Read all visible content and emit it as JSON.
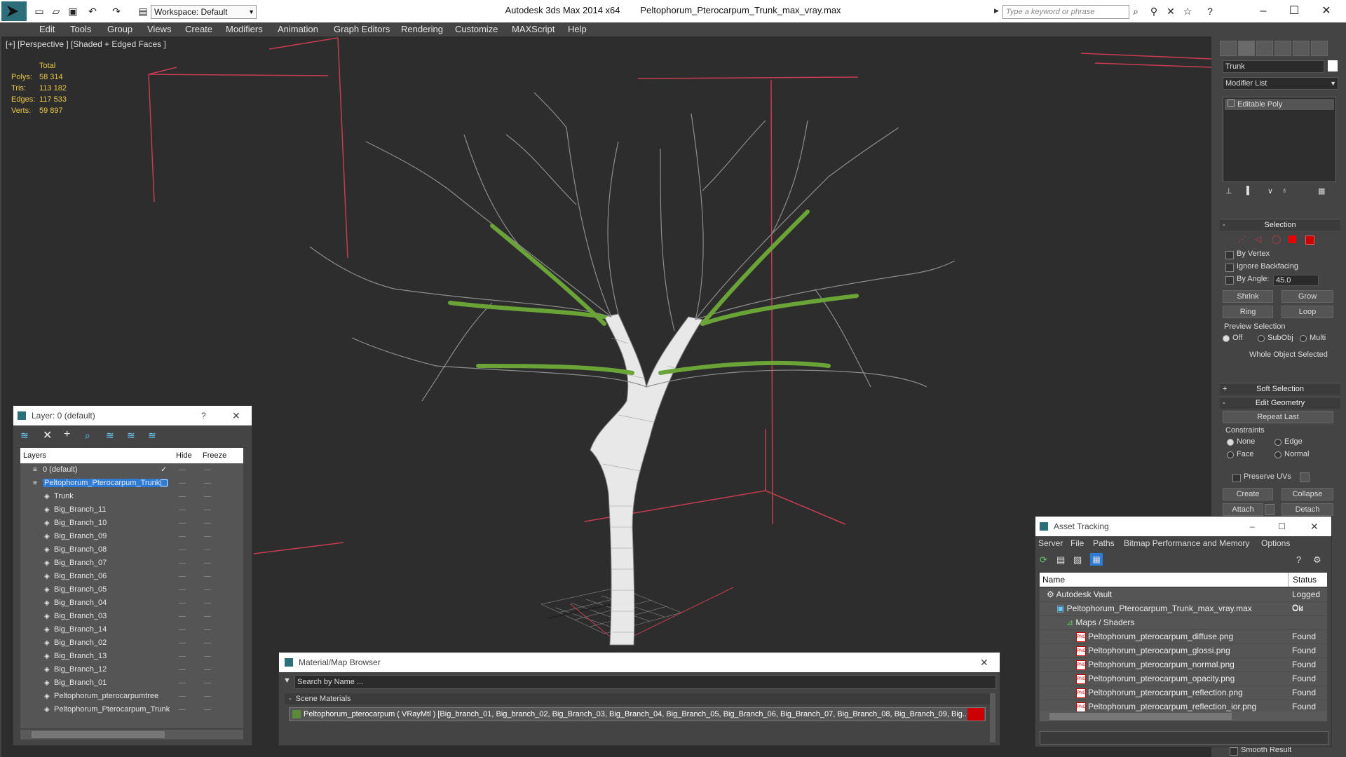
{
  "titlebar": {
    "workspace": "Workspace: Default",
    "app_title": "Autodesk 3ds Max  2014 x64",
    "file_title": "Peltophorum_Pterocarpum_Trunk_max_vray.max",
    "search_placeholder": "Type a keyword or phrase"
  },
  "menubar": [
    "Edit",
    "Tools",
    "Group",
    "Views",
    "Create",
    "Modifiers",
    "Animation",
    "Graph Editors",
    "Rendering",
    "Customize",
    "MAXScript",
    "Help"
  ],
  "viewport": {
    "label": "[+] [Perspective ] [Shaded + Edged Faces ]",
    "stats": {
      "header": "Total",
      "rows": [
        {
          "label": "Polys:",
          "value": "58 314"
        },
        {
          "label": "Tris:",
          "value": "113 182"
        },
        {
          "label": "Edges:",
          "value": "117 533"
        },
        {
          "label": "Verts:",
          "value": "59 897"
        }
      ]
    }
  },
  "cmdpanel": {
    "object_name": "Trunk",
    "modifier_list": "Modifier List",
    "stack_item": "Editable Poly",
    "selection": {
      "header": "Selection",
      "by_vertex": "By Vertex",
      "ignore_backfacing": "Ignore Backfacing",
      "by_angle": "By Angle:",
      "angle_value": "45.0",
      "shrink": "Shrink",
      "grow": "Grow",
      "ring": "Ring",
      "loop": "Loop",
      "preview_selection": "Preview Selection",
      "off": "Off",
      "subobj": "SubObj",
      "multi": "Multi",
      "status": "Whole Object Selected"
    },
    "soft_selection": "Soft Selection",
    "edit_geometry": {
      "header": "Edit Geometry",
      "repeat_last": "Repeat Last",
      "constraints": "Constraints",
      "none": "None",
      "edge": "Edge",
      "face": "Face",
      "normal": "Normal",
      "preserve_uvs": "Preserve UVs",
      "create": "Create",
      "collapse": "Collapse",
      "attach": "Attach",
      "detach": "Detach"
    },
    "smooth_result": "Smooth Result"
  },
  "layerwin": {
    "title": "Layer: 0 (default)",
    "help": "?",
    "columns": {
      "layers": "Layers",
      "hide": "Hide",
      "freeze": "Freeze"
    },
    "rows": [
      {
        "name": "0 (default)",
        "level": 1
      },
      {
        "name": "Peltophorum_Pterocarpum_Trunk",
        "level": 1,
        "selected": true
      },
      {
        "name": "Trunk",
        "level": 2
      },
      {
        "name": "Big_Branch_11",
        "level": 2
      },
      {
        "name": "Big_Branch_10",
        "level": 2
      },
      {
        "name": "Big_Branch_09",
        "level": 2
      },
      {
        "name": "Big_Branch_08",
        "level": 2
      },
      {
        "name": "Big_Branch_07",
        "level": 2
      },
      {
        "name": "Big_Branch_06",
        "level": 2
      },
      {
        "name": "Big_Branch_05",
        "level": 2
      },
      {
        "name": "Big_Branch_04",
        "level": 2
      },
      {
        "name": "Big_Branch_03",
        "level": 2
      },
      {
        "name": "Big_Branch_14",
        "level": 2
      },
      {
        "name": "Big_Branch_02",
        "level": 2
      },
      {
        "name": "Big_Branch_13",
        "level": 2
      },
      {
        "name": "Big_Branch_12",
        "level": 2
      },
      {
        "name": "Big_Branch_01",
        "level": 2
      },
      {
        "name": "Peltophorum_pterocarpumtree",
        "level": 2
      },
      {
        "name": "Peltophorum_Pterocarpum_Trunk",
        "level": 2
      }
    ]
  },
  "matwin": {
    "title": "Material/Map Browser",
    "search_placeholder": "Search by Name ...",
    "section": "Scene Materials",
    "material": "Peltophorum_pterocarpum  ( VRayMtl )  [Big_branch_01, Big_branch_02, Big_Branch_03, Big_Branch_04, Big_Branch_05, Big_Branch_06, Big_Branch_07, Big_Branch_08, Big_Branch_09, Big..."
  },
  "assetwin": {
    "title": "Asset Tracking",
    "menu": [
      "Server",
      "File",
      "Paths",
      "Bitmap Performance and Memory",
      "Options"
    ],
    "columns": {
      "name": "Name",
      "status": "Status"
    },
    "rows": [
      {
        "name": "Autodesk Vault",
        "status": "Logged Ou",
        "level": 1,
        "icon": "vault"
      },
      {
        "name": "Peltophorum_Pterocarpum_Trunk_max_vray.max",
        "status": "Ok",
        "level": 2,
        "icon": "max"
      },
      {
        "name": "Maps / Shaders",
        "status": "",
        "level": 3,
        "icon": "maps"
      },
      {
        "name": "Peltophorum_pterocarpum_diffuse.png",
        "status": "Found",
        "level": 4,
        "icon": "png"
      },
      {
        "name": "Peltophorum_pterocarpum_glossi.png",
        "status": "Found",
        "level": 4,
        "icon": "png"
      },
      {
        "name": "Peltophorum_pterocarpum_normal.png",
        "status": "Found",
        "level": 4,
        "icon": "png"
      },
      {
        "name": "Peltophorum_pterocarpum_opacity.png",
        "status": "Found",
        "level": 4,
        "icon": "png"
      },
      {
        "name": "Peltophorum_pterocarpum_reflection.png",
        "status": "Found",
        "level": 4,
        "icon": "png"
      },
      {
        "name": "Peltophorum_pterocarpum_reflection_ior.png",
        "status": "Found",
        "level": 4,
        "icon": "png"
      }
    ]
  },
  "colors": {
    "accent": "#2e7bd6",
    "selected_row": "#2e7bd6",
    "stat_text": "#e8c64a",
    "viewport_bg": "#2d2d2d",
    "red_box": "#c83c50"
  }
}
